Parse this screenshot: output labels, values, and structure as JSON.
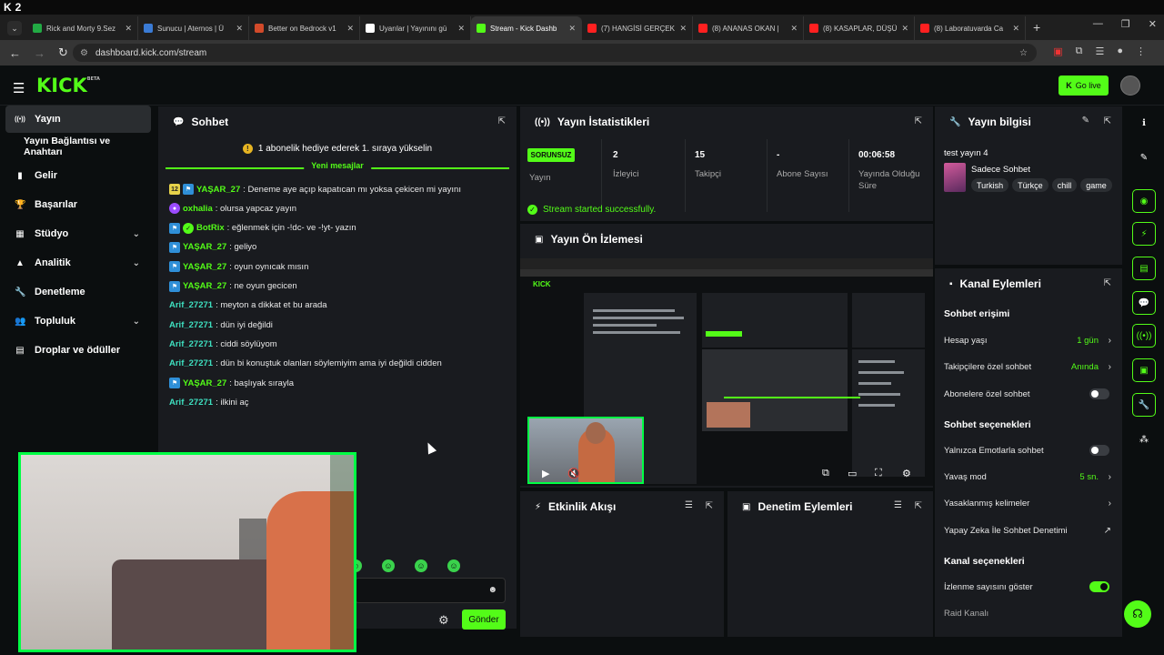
{
  "os": {
    "app_badge": "2"
  },
  "browser": {
    "tabs": [
      {
        "label": "Rick and Morty 9.Sez",
        "color": "#22aa44"
      },
      {
        "label": "Sunucu | Aternos | Ü",
        "color": "#3a7bd5"
      },
      {
        "label": "Better on Bedrock v1",
        "color": "#d24a2a"
      },
      {
        "label": "Uyarılar | Yayınını gü",
        "color": "#ffffff"
      },
      {
        "label": "Stream - Kick Dashb",
        "color": "#53fc18"
      },
      {
        "label": "(7) HANGİSİ GERÇEK",
        "color": "#ff2020"
      },
      {
        "label": "(8) ANANAS OKAN |",
        "color": "#ff2020"
      },
      {
        "label": "(8) KASAPLAR, DÜŞÜ",
        "color": "#ff2020"
      },
      {
        "label": "(8) Laboratuvarda Ca",
        "color": "#ff2020"
      }
    ],
    "active_tab": 4,
    "url": "dashboard.kick.com/stream"
  },
  "header": {
    "logo": "KICK",
    "logo_tag": "BETA",
    "go_live": "Go live"
  },
  "sidebar": {
    "items": [
      {
        "label": "Yayın",
        "icon": "broadcast-icon",
        "glyph": "((•))"
      },
      {
        "label": "Yayın Bağlantısı ve Anahtarı",
        "icon": "",
        "glyph": ""
      },
      {
        "label": "Gelir",
        "icon": "chart-icon",
        "glyph": "▮"
      },
      {
        "label": "Başarılar",
        "icon": "trophy-icon",
        "glyph": "🏆"
      },
      {
        "label": "Stüdyo",
        "icon": "studio-icon",
        "glyph": "▦"
      },
      {
        "label": "Analitik",
        "icon": "analytics-icon",
        "glyph": "▲"
      },
      {
        "label": "Denetleme",
        "icon": "wrench-icon",
        "glyph": "🔧"
      },
      {
        "label": "Topluluk",
        "icon": "community-icon",
        "glyph": "👥"
      },
      {
        "label": "Droplar ve ödüller",
        "icon": "gift-icon",
        "glyph": "▤"
      }
    ]
  },
  "chat": {
    "title": "Sohbet",
    "pinned": "1 abonelik hediye ederek 1. sıraya yükselin",
    "new_messages": "Yeni mesajlar",
    "messages": [
      {
        "user": "YAŞAR_27",
        "text": ": Deneme aye açıp kapatıcan mı yoksa çekicen mi yayını",
        "badges": [
          "sub",
          "blue"
        ],
        "sub_months": "12",
        "color": "green"
      },
      {
        "user": "oxhalia",
        "text": ": olursa yapcaz yayın",
        "badges": [
          "purple"
        ],
        "color": "green"
      },
      {
        "user": "BotRix",
        "text": ": eğlenmek için -!dc- ve -!yt- yazın",
        "badges": [
          "blue",
          "green"
        ],
        "color": "green"
      },
      {
        "user": "YAŞAR_27",
        "text": ": geliyo",
        "badges": [
          "blue"
        ],
        "color": "green"
      },
      {
        "user": "YAŞAR_27",
        "text": ": oyun oynıcak mısın",
        "badges": [
          "blue"
        ],
        "color": "green"
      },
      {
        "user": "YAŞAR_27",
        "text": ": ne oyun gecicen",
        "badges": [
          "blue"
        ],
        "color": "green"
      },
      {
        "user": "Arif_27271",
        "text": ": meyton a dikkat et bu arada",
        "badges": [],
        "color": "cyan"
      },
      {
        "user": "Arif_27271",
        "text": ": dün iyi değildi",
        "badges": [],
        "color": "cyan"
      },
      {
        "user": "Arif_27271",
        "text": ": ciddi söylüyom",
        "badges": [],
        "color": "cyan"
      },
      {
        "user": "Arif_27271",
        "text": ": dün bi konuştuk olanları söylemiyim ama iyi değildi cidden",
        "badges": [],
        "color": "cyan"
      },
      {
        "user": "YAŞAR_27",
        "text": ": başlıyak sırayla",
        "badges": [
          "blue"
        ],
        "color": "green"
      },
      {
        "user": "Arif_27271",
        "text": ": ilkini aç",
        "badges": [],
        "color": "cyan"
      }
    ],
    "send": "Gönder"
  },
  "stats": {
    "title": "Yayın İstatistikleri",
    "status_badge": "SORUNSUZ",
    "status_label": "Yayın",
    "items": [
      {
        "value": "2",
        "label": "İzleyici"
      },
      {
        "value": "15",
        "label": "Takipçi"
      },
      {
        "value": "-",
        "label": "Abone Sayısı"
      },
      {
        "value": "00:06:58",
        "label": "Yayında Olduğu Süre"
      }
    ],
    "success": "Stream started successfully."
  },
  "preview": {
    "title": "Yayın Ön İzlemesi"
  },
  "events": {
    "title": "Etkinlik Akışı"
  },
  "moderation": {
    "title": "Denetim Eylemleri"
  },
  "info": {
    "title": "Yayın bilgisi",
    "stream_title": "test yayın 4",
    "category": "Sadece Sohbet",
    "tags": [
      "Turkish",
      "Türkçe",
      "chill",
      "game"
    ]
  },
  "actions": {
    "title": "Kanal Eylemleri",
    "chat_access": "Sohbet erişimi",
    "account_age": {
      "label": "Hesap yaşı",
      "value": "1 gün"
    },
    "followers_only": {
      "label": "Takipçilere özel sohbet",
      "value": "Anında"
    },
    "subs_only": {
      "label": "Abonelere özel sohbet",
      "on": false
    },
    "chat_options": "Sohbet seçenekleri",
    "emote_only": {
      "label": "Yalnızca Emotlarla sohbet",
      "on": false
    },
    "slow_mode": {
      "label": "Yavaş mod",
      "value": "5 sn."
    },
    "banned_words": {
      "label": "Yasaklanmış kelimeler"
    },
    "ai_mod": {
      "label": "Yapay Zeka İle Sohbet Denetimi"
    },
    "channel_options": "Kanal seçenekleri",
    "show_views": {
      "label": "İzlenme sayısını göster",
      "on": true
    },
    "raid": {
      "label": "Raid Kanalı"
    }
  }
}
